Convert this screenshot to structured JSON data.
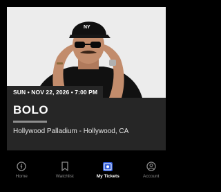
{
  "event": {
    "date_line": "SUN • NOV 22, 2026 • 7:00 PM",
    "title": "BOLO",
    "venue": "Hollywood Palladium - Hollywood, CA",
    "hero_image": "artist-photo"
  },
  "nav": {
    "tabs": [
      {
        "label": "Home",
        "icon": "home-icon",
        "active": false
      },
      {
        "label": "Watchlist",
        "icon": "bookmark-icon",
        "active": false
      },
      {
        "label": "My Tickets",
        "icon": "ticket-icon",
        "active": true
      },
      {
        "label": "Account",
        "icon": "account-icon",
        "active": false
      }
    ]
  },
  "colors": {
    "background": "#000000",
    "card": "#262626",
    "active_tab_icon": "#2f5bd8",
    "inactive": "#8a8a8a"
  }
}
